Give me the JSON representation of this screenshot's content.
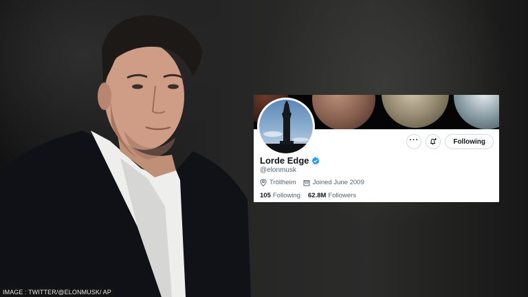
{
  "profile": {
    "display_name": "Lorde Edge",
    "handle": "@elonmusk",
    "location": "Tröllheim",
    "joined": "Joined June 2009",
    "following_count": "105",
    "following_label": "Following",
    "followers_count": "62.8M",
    "followers_label": "Followers",
    "follow_button_label": "Following",
    "verified_color": "#1d9bf0",
    "icons": [
      "more-icon",
      "notification-bell-plus-icon",
      "location-pin-icon",
      "calendar-icon",
      "verified-badge-icon"
    ]
  },
  "caption": {
    "text": "IMAGE : TWITTER/@ELONMUSK/ AP"
  }
}
